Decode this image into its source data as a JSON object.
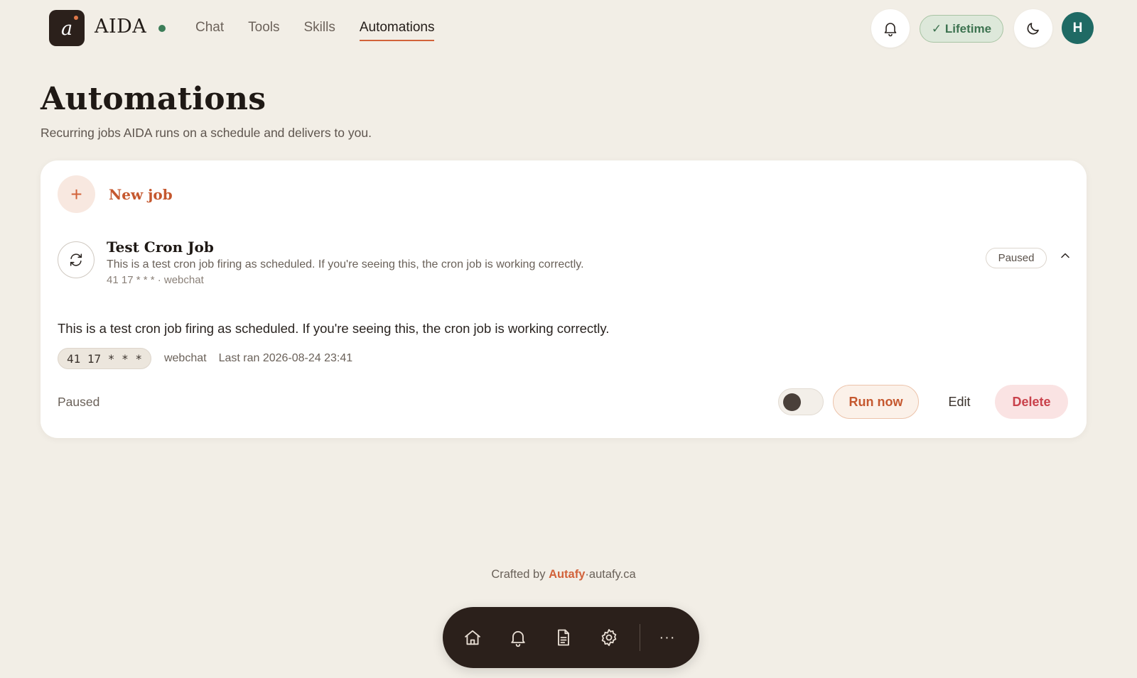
{
  "app": {
    "logo_letter": "a",
    "name": "AIDA"
  },
  "nav": {
    "items": [
      {
        "label": "Chat"
      },
      {
        "label": "Tools"
      },
      {
        "label": "Skills"
      },
      {
        "label": "Automations"
      }
    ],
    "active": "Automations"
  },
  "header": {
    "lifetime_label": "✓ Lifetime",
    "avatar_initial": "H",
    "icons": [
      "bell-icon",
      "moon-icon"
    ]
  },
  "page": {
    "title": "Automations",
    "subtitle": "Recurring jobs AIDA runs on a schedule and delivers to you."
  },
  "new_job": {
    "icon": "+",
    "label": "New job"
  },
  "job": {
    "title": "Test Cron Job",
    "description": "This is a test cron job firing as scheduled. If you're seeing this, the cron job is working correctly.",
    "meta": "41 17 * * * · webchat",
    "badge": "Paused",
    "detail_text": "This is a test cron job firing as scheduled. If you're seeing this, the cron job is working correctly.",
    "cron": "41 17 * * *",
    "channel": "webchat",
    "last_ran": "Last ran 2026-08-24 23:41",
    "status": "Paused",
    "enabled": false,
    "actions": {
      "run": "Run now",
      "edit": "Edit",
      "delete": "Delete"
    }
  },
  "footer": {
    "crafted_prefix": "Crafted by",
    "brand": "Autafy",
    "separator": "·",
    "site": "autafy.ca"
  },
  "dock": {
    "icons": [
      "home-icon",
      "bell-icon",
      "document-icon",
      "gear-icon",
      "more-icon"
    ],
    "more_glyph": "···"
  },
  "colors": {
    "accent": "#d2623a",
    "background": "#f2eee6",
    "dark": "#2b201b",
    "online": "#3c7d58",
    "avatar": "#1f6a64",
    "delete": "#c9414b"
  }
}
